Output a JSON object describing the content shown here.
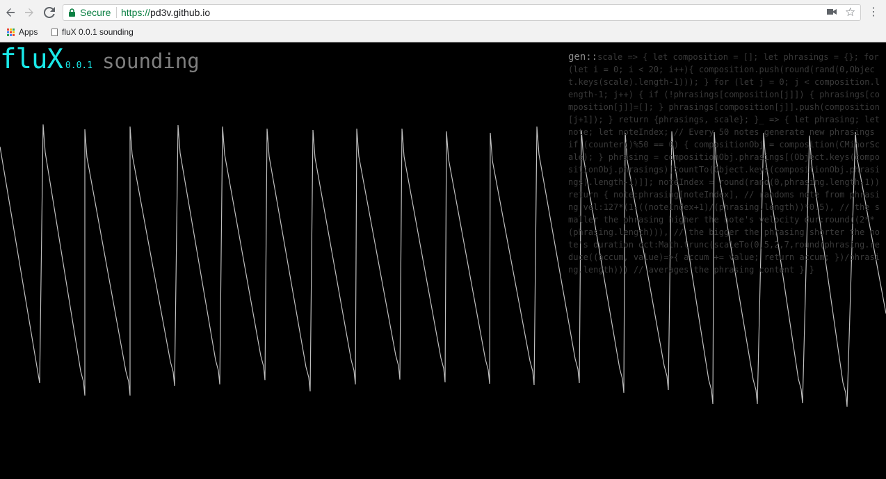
{
  "browser": {
    "back_icon": "arrow-left-icon",
    "forward_icon": "arrow-right-icon",
    "reload_icon": "reload-icon",
    "secure_label": "Secure",
    "url_scheme": "https://",
    "url_host": "pd3v.github.io",
    "camera_icon": "video-camera-icon",
    "star_icon": "star-icon",
    "menu_icon": "more-vert-icon"
  },
  "bookmarks": {
    "apps_label": "Apps",
    "items": [
      {
        "label": "fluX 0.0.1 sounding"
      }
    ]
  },
  "page": {
    "title": "fluX",
    "version": "0.0.1",
    "status": "sounding",
    "code_label": "gen::",
    "code_text": "scale => { let composition = []; let phrasings = {}; for (let i = 0; i < 20; i++){ composition.push(round(rand(0,Object.keys(scale).length-1))); } for (let j = 0; j < composition.length-1; j++) { if (!phrasings[composition[j]]) { phrasings[composition[j]]=[]; } phrasings[composition[j]].push(composition[j+1]); } return {phrasings, scale}; }_ => { let phrasing; let note; let noteIndex; // Every 50 notes generate new phrasings if (counter()%50 == 0) { compositionObj = composition(CMinorScale); } phrasing = compositionObj.phrasings[(Object.keys(compositionObj.phrasings)[countTo(Object.keys(compositionObj.phrasings).length-1)]]; noteIndex = round(rand(0,phrasing.length-1)) return { note:phrasing[noteIndex], // randoms note from phrasing vel:127*(1-((noteIndex+1)/(phrasing.length))*0.5), // the smaller the phrasing higher the note's velocity dur:round((2**(phrasing.length))), // the bigger the phrasing shorter the note's duration oct:Math.trunc(scaleTo(0,5,2,7,round(phrasing.reduce((accum, value)=>{ accum += value; return accum; })/phrasing.length))) // averages the phrasing content } }"
  },
  "colors": {
    "accent": "#19e8e8",
    "wave": "#bfbfbf",
    "secure": "#0b8043",
    "background": "#000000"
  }
}
